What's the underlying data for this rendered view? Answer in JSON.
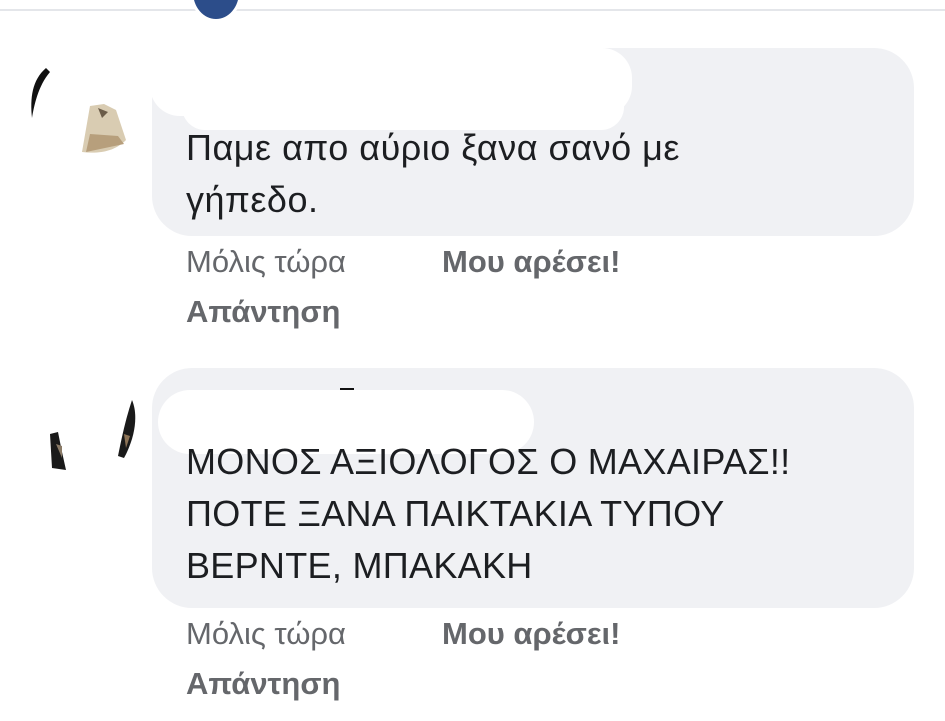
{
  "comments": [
    {
      "author": "",
      "text": "Παμε απο αύριο ξανα σανό με\nγήπεδο.",
      "time": "Μόλις τώρα",
      "like_label": "Μου αρέσει!",
      "reply_label": "Απάντηση"
    },
    {
      "author": "",
      "text": "ΜΟΝΟΣ ΑΞΙΟΛΟΓΟΣ Ο ΜΑΧΑΙΡΑΣ!!\nΠΟΤΕ ΞΑΝΑ ΠΑΙΚΤΑΚΙΑ ΤΥΠΟΥ\nΒΕΡΝΤΕ, ΜΠΑΚΑΚΗ",
      "time": "Μόλις τώρα",
      "like_label": "Μου αρέσει!",
      "reply_label": "Απάντηση"
    }
  ],
  "colors": {
    "bubble": "#f0f1f4",
    "text": "#1c1e21",
    "meta": "#65676b",
    "redaction": "#ffffff"
  },
  "icons": [
    "avatar"
  ]
}
